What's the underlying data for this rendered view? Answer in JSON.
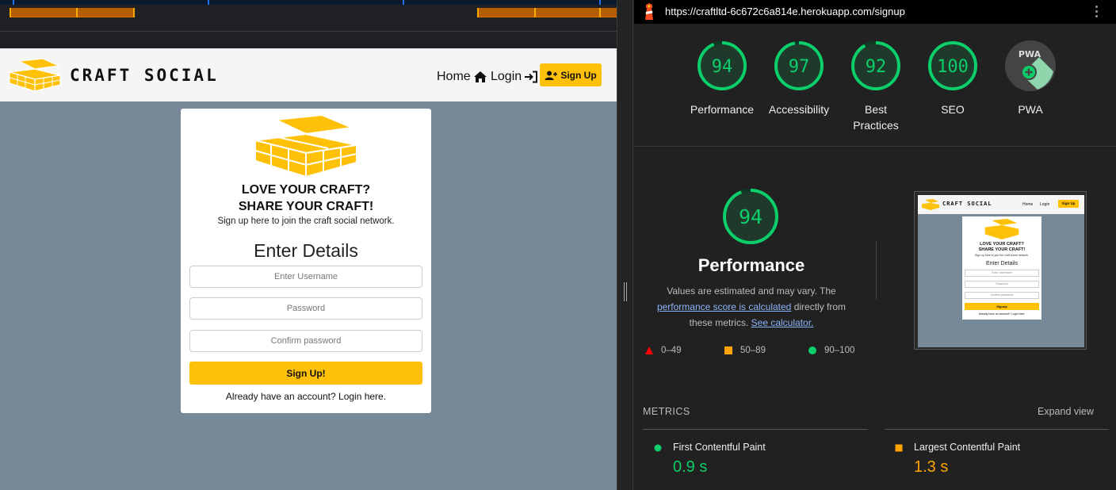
{
  "site": {
    "brand": "CRAFT SOCIAL",
    "nav": {
      "home": "Home",
      "login": "Login",
      "signup": "Sign Up"
    },
    "card": {
      "headline_1": "LOVE YOUR CRAFT?",
      "headline_2": "SHARE YOUR CRAFT!",
      "subline": "Sign up here to join the craft social network.",
      "form_title": "Enter Details",
      "username_placeholder": "Enter Username",
      "password_placeholder": "Password",
      "confirm_placeholder": "Confirm password",
      "submit_label": "Sign Up!",
      "already_text": "Already have an account? Login here."
    },
    "colors": {
      "accent": "#ffc107",
      "background": "#778899",
      "navbar": "#f5f5f5"
    }
  },
  "lighthouse": {
    "url": "https://craftltd-6c672c6a814e.herokuapp.com/signup",
    "scores": [
      {
        "label": "Performance",
        "value": "94"
      },
      {
        "label": "Accessibility",
        "value": "97"
      },
      {
        "label": "Best Practices",
        "value": "92"
      },
      {
        "label": "SEO",
        "value": "100"
      },
      {
        "label": "PWA",
        "value": "PWA"
      }
    ],
    "performance": {
      "score": "94",
      "title": "Performance",
      "desc_1": "Values are estimated and may vary. The",
      "link_1": "performance score is calculated",
      "desc_2": "directly from",
      "desc_3": "these metrics.",
      "link_2": "See calculator."
    },
    "legend": [
      {
        "range": "0–49",
        "icon": "triangle-icon",
        "color": "#ff0000"
      },
      {
        "range": "50–89",
        "icon": "square-icon",
        "color": "#ffa400"
      },
      {
        "range": "90–100",
        "icon": "circle-icon",
        "color": "#0cce6b"
      }
    ],
    "metrics_title": "METRICS",
    "expand_label": "Expand view",
    "metrics": [
      {
        "name": "First Contentful Paint",
        "value": "0.9 s",
        "color": "#0cce6b"
      },
      {
        "name": "Largest Contentful Paint",
        "value": "1.3 s",
        "color": "#ffa400"
      }
    ],
    "thumbnail": {
      "brand": "CRAFT SOCIAL",
      "home": "Home",
      "login": "Login",
      "signup": "Sign Up",
      "headline_1": "LOVE YOUR CRAFT?",
      "headline_2": "SHARE YOUR CRAFT!",
      "subline": "Sign up here to join the craft social network.",
      "form_title": "Enter Details",
      "username": "Enter Username",
      "password": "Password",
      "confirm": "Confirm password",
      "submit": "Signup",
      "already": "Already have an account? Login here."
    },
    "colors": {
      "pass": "#0cce6b",
      "average": "#ffa400",
      "fail": "#ff0000"
    }
  }
}
